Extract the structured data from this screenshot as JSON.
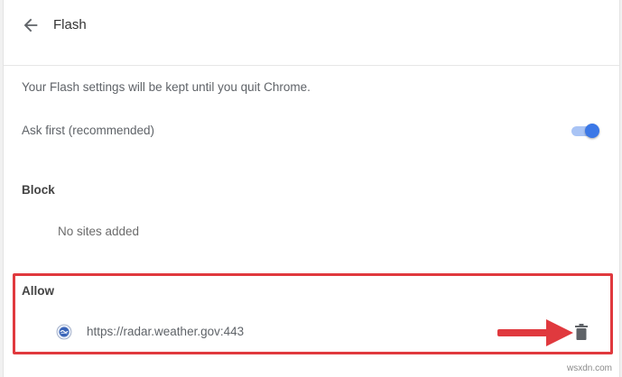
{
  "header": {
    "title": "Flash"
  },
  "info": {
    "text": "Your Flash settings will be kept until you quit Chrome."
  },
  "ask_first": {
    "label": "Ask first (recommended)",
    "enabled": true
  },
  "block": {
    "heading": "Block",
    "empty_text": "No sites added"
  },
  "allow": {
    "heading": "Allow",
    "sites": [
      {
        "url": "https://radar.weather.gov:443"
      }
    ]
  },
  "watermark": "wsxdn.com",
  "colors": {
    "accent": "#3b78e7",
    "toggle_track": "#a9c4f5",
    "highlight": "#e0393e"
  },
  "icons": {
    "back": "arrow-back-icon",
    "site": "site-favicon-icon",
    "delete": "trash-icon"
  }
}
